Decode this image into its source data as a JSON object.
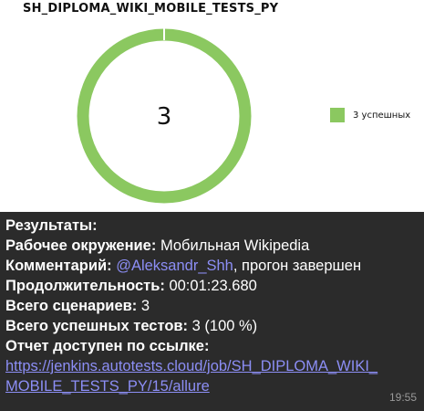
{
  "report": {
    "title": "SH_DIPLOMA_WIKI_MOBILE_TESTS_PY",
    "total_count": "3",
    "legend_label": "3 успешных",
    "colors": {
      "passed": "#8bc860",
      "link": "#8c8ef5"
    }
  },
  "chart_data": {
    "type": "pie",
    "categories": [
      "3 успешных"
    ],
    "values": [
      3
    ],
    "center_label": "3",
    "legend_position": "right"
  },
  "message": {
    "results_label": "Результаты:",
    "environment_label": "Рабочее окружение:",
    "environment_value": " Мобильная Wikipedia",
    "comment_label": "Комментарий:",
    "comment_mention": "@Aleksandr_Shh",
    "comment_rest": ", прогон завершен",
    "duration_label": "Продолжительность:",
    "duration_value": " 00:01:23.680",
    "scenarios_label": "Всего сценариев:",
    "scenarios_value": " 3",
    "passed_label": "Всего успешных тестов:",
    "passed_value": " 3 (100 %)",
    "report_link_label": "Отчет доступен по ссылке:",
    "link_line1": "https://jenkins.autotests.cloud/job/SH_DIPLOMA_WIKI_",
    "link_line2": "MOBILE_TESTS_PY/15/allure",
    "time": "19:55"
  }
}
